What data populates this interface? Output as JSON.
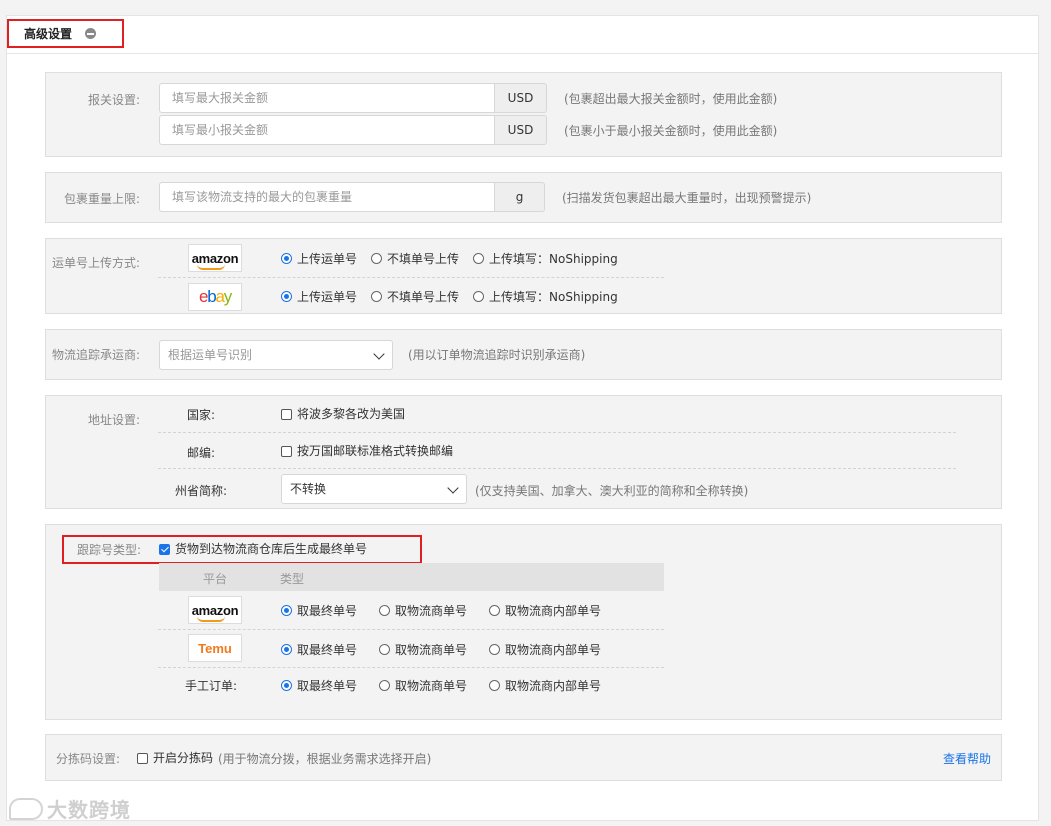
{
  "header": {
    "title": "高级设置"
  },
  "customs": {
    "label": "报关设置:",
    "max_placeholder": "填写最大报关金额",
    "min_placeholder": "填写最小报关金额",
    "currency": "USD",
    "max_hint": "(包裹超出最大报关金额时，使用此金额)",
    "min_hint": "(包裹小于最小报关金额时，使用此金额)"
  },
  "weight": {
    "label": "包裹重量上限:",
    "placeholder": "填写该物流支持的最大的包裹重量",
    "unit": "g",
    "hint": "(扫描发货包裹超出最大重量时，出现预警提示)"
  },
  "upload": {
    "label": "运单号上传方式:",
    "rows": [
      {
        "platform": "amazon",
        "options": [
          "上传运单号",
          "不填单号上传",
          "上传填写：NoShipping"
        ],
        "selected": 0
      },
      {
        "platform": "ebay",
        "options": [
          "上传运单号",
          "不填单号上传",
          "上传填写：NoShipping"
        ],
        "selected": 0
      }
    ]
  },
  "carrier": {
    "label": "物流追踪承运商:",
    "value": "根据运单号识别",
    "hint": "(用以订单物流追踪时识别承运商)"
  },
  "address": {
    "label": "地址设置:",
    "country_label": "国家:",
    "country_option": "将波多黎各改为美国",
    "zip_label": "邮编:",
    "zip_option": "按万国邮联标准格式转换邮编",
    "state_label": "州省简称:",
    "state_value": "不转换",
    "state_hint": "(仅支持美国、加拿大、澳大利亚的简称和全称转换)"
  },
  "tracking": {
    "label": "跟踪号类型:",
    "checkbox_label": "货物到达物流商仓库后生成最终单号",
    "col_platform": "平台",
    "col_type": "类型",
    "manual_label": "手工订单:",
    "options": [
      "取最终单号",
      "取物流商单号",
      "取物流商内部单号"
    ],
    "rows": [
      {
        "platform": "amazon",
        "selected": 0
      },
      {
        "platform": "Temu",
        "selected": 0
      },
      {
        "platform": "manual",
        "selected": 0
      }
    ]
  },
  "sorting": {
    "label": "分拣码设置:",
    "checkbox_label": "开启分拣码",
    "hint": "(用于物流分拨，根据业务需求选择开启)",
    "help_link": "查看帮助"
  },
  "logos": {
    "amazon": "amazon",
    "ebay_e": "e",
    "ebay_b": "b",
    "ebay_a": "a",
    "ebay_y": "y",
    "temu": "Temu"
  },
  "watermark": {
    "text": "大数跨境"
  },
  "colors": {
    "accent": "#1a73e8",
    "highlight_border": "#e02020",
    "temu": "#f07a1e",
    "amazon_smile": "#f29a1d"
  }
}
